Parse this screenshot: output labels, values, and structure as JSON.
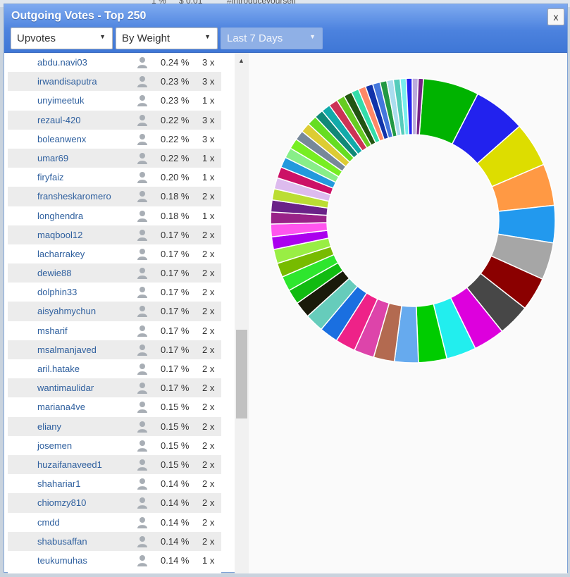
{
  "dialog": {
    "title": "Outgoing Votes - Top 250",
    "close_label": "x"
  },
  "filters": {
    "vote_type": "Upvotes",
    "sort": "By Weight",
    "period": "Last 7 Days"
  },
  "background": {
    "fragment_left": "1 %",
    "fragment_mid": "$ 0.01",
    "fragment_right": "#introduceyourself"
  },
  "rows": [
    {
      "user": "abdu.navi03",
      "pct": "0.24 %",
      "count": "3 x"
    },
    {
      "user": "irwandisaputra",
      "pct": "0.23 %",
      "count": "3 x"
    },
    {
      "user": "unyimeetuk",
      "pct": "0.23 %",
      "count": "1 x"
    },
    {
      "user": "rezaul-420",
      "pct": "0.22 %",
      "count": "3 x"
    },
    {
      "user": "boleanwenx",
      "pct": "0.22 %",
      "count": "3 x"
    },
    {
      "user": "umar69",
      "pct": "0.22 %",
      "count": "1 x"
    },
    {
      "user": "firyfaiz",
      "pct": "0.20 %",
      "count": "1 x"
    },
    {
      "user": "fransheskaromero",
      "pct": "0.18 %",
      "count": "2 x"
    },
    {
      "user": "longhendra",
      "pct": "0.18 %",
      "count": "1 x"
    },
    {
      "user": "maqbool12",
      "pct": "0.17 %",
      "count": "2 x"
    },
    {
      "user": "lacharrakey",
      "pct": "0.17 %",
      "count": "2 x"
    },
    {
      "user": "dewie88",
      "pct": "0.17 %",
      "count": "2 x"
    },
    {
      "user": "dolphin33",
      "pct": "0.17 %",
      "count": "2 x"
    },
    {
      "user": "aisyahmychun",
      "pct": "0.17 %",
      "count": "2 x"
    },
    {
      "user": "msharif",
      "pct": "0.17 %",
      "count": "2 x"
    },
    {
      "user": "msalmanjaved",
      "pct": "0.17 %",
      "count": "2 x"
    },
    {
      "user": "aril.hatake",
      "pct": "0.17 %",
      "count": "2 x"
    },
    {
      "user": "wantimaulidar",
      "pct": "0.17 %",
      "count": "2 x"
    },
    {
      "user": "mariana4ve",
      "pct": "0.15 %",
      "count": "2 x"
    },
    {
      "user": "eliany",
      "pct": "0.15 %",
      "count": "2 x"
    },
    {
      "user": "josemen",
      "pct": "0.15 %",
      "count": "2 x"
    },
    {
      "user": "huzaifanaveed1",
      "pct": "0.15 %",
      "count": "2 x"
    },
    {
      "user": "shahariar1",
      "pct": "0.14 %",
      "count": "2 x"
    },
    {
      "user": "chiomzy810",
      "pct": "0.14 %",
      "count": "2 x"
    },
    {
      "user": "cmdd",
      "pct": "0.14 %",
      "count": "2 x"
    },
    {
      "user": "shabusaffan",
      "pct": "0.14 %",
      "count": "2 x"
    },
    {
      "user": "teukumuhas",
      "pct": "0.14 %",
      "count": "1 x"
    }
  ],
  "icons": {
    "person": "person-icon",
    "caret": "caret-down-icon",
    "scroll_up": "scroll-up-arrow-icon"
  },
  "chart_data": {
    "type": "pie",
    "style": "donut",
    "slices": [
      {
        "value": 7.5,
        "color": "#00b300"
      },
      {
        "value": 7.0,
        "color": "#2222ee"
      },
      {
        "value": 6.0,
        "color": "#dddd00"
      },
      {
        "value": 5.6,
        "color": "#ff9944"
      },
      {
        "value": 5.0,
        "color": "#2299ee"
      },
      {
        "value": 5.0,
        "color": "#a6a6a6"
      },
      {
        "value": 4.5,
        "color": "#8b0000"
      },
      {
        "value": 4.3,
        "color": "#474747"
      },
      {
        "value": 4.2,
        "color": "#dd00dd"
      },
      {
        "value": 4.0,
        "color": "#22eeee"
      },
      {
        "value": 3.8,
        "color": "#00cc00"
      },
      {
        "value": 3.2,
        "color": "#66aaee"
      },
      {
        "value": 2.8,
        "color": "#b36a50"
      },
      {
        "value": 2.7,
        "color": "#dd44aa"
      },
      {
        "value": 2.7,
        "color": "#ee2288"
      },
      {
        "value": 2.5,
        "color": "#1a6fe0"
      },
      {
        "value": 2.5,
        "color": "#66ccbb"
      },
      {
        "value": 2.2,
        "color": "#1a1a0a"
      },
      {
        "value": 2.0,
        "color": "#11bb11"
      },
      {
        "value": 2.0,
        "color": "#2ee62e"
      },
      {
        "value": 1.9,
        "color": "#77bb00"
      },
      {
        "value": 1.9,
        "color": "#99ee44"
      },
      {
        "value": 1.7,
        "color": "#aa00ee"
      },
      {
        "value": 1.7,
        "color": "#ff55ee"
      },
      {
        "value": 1.6,
        "color": "#992288"
      },
      {
        "value": 1.6,
        "color": "#6a2288"
      },
      {
        "value": 1.5,
        "color": "#bbdd33"
      },
      {
        "value": 1.5,
        "color": "#ddbbee"
      },
      {
        "value": 1.5,
        "color": "#cc1166"
      },
      {
        "value": 1.4,
        "color": "#2299dd"
      },
      {
        "value": 1.4,
        "color": "#88ee88"
      },
      {
        "value": 1.4,
        "color": "#77ee22"
      },
      {
        "value": 1.3,
        "color": "#778899"
      },
      {
        "value": 1.3,
        "color": "#ddcc33"
      },
      {
        "value": 1.3,
        "color": "#66dd22"
      },
      {
        "value": 1.2,
        "color": "#118877"
      },
      {
        "value": 1.2,
        "color": "#11aaaa"
      },
      {
        "value": 1.2,
        "color": "#cc3355"
      },
      {
        "value": 1.1,
        "color": "#66cc22"
      },
      {
        "value": 1.1,
        "color": "#225511"
      },
      {
        "value": 1.0,
        "color": "#33ddaa"
      },
      {
        "value": 1.0,
        "color": "#ff8866"
      },
      {
        "value": 1.0,
        "color": "#1133aa"
      },
      {
        "value": 1.0,
        "color": "#4477dd"
      },
      {
        "value": 0.9,
        "color": "#229944"
      },
      {
        "value": 0.9,
        "color": "#aaddee"
      },
      {
        "value": 0.9,
        "color": "#55ccbb"
      },
      {
        "value": 0.8,
        "color": "#77eeee"
      },
      {
        "value": 0.8,
        "color": "#2222ee"
      },
      {
        "value": 0.8,
        "color": "#bbaadd"
      },
      {
        "value": 0.7,
        "color": "#772288"
      }
    ]
  }
}
